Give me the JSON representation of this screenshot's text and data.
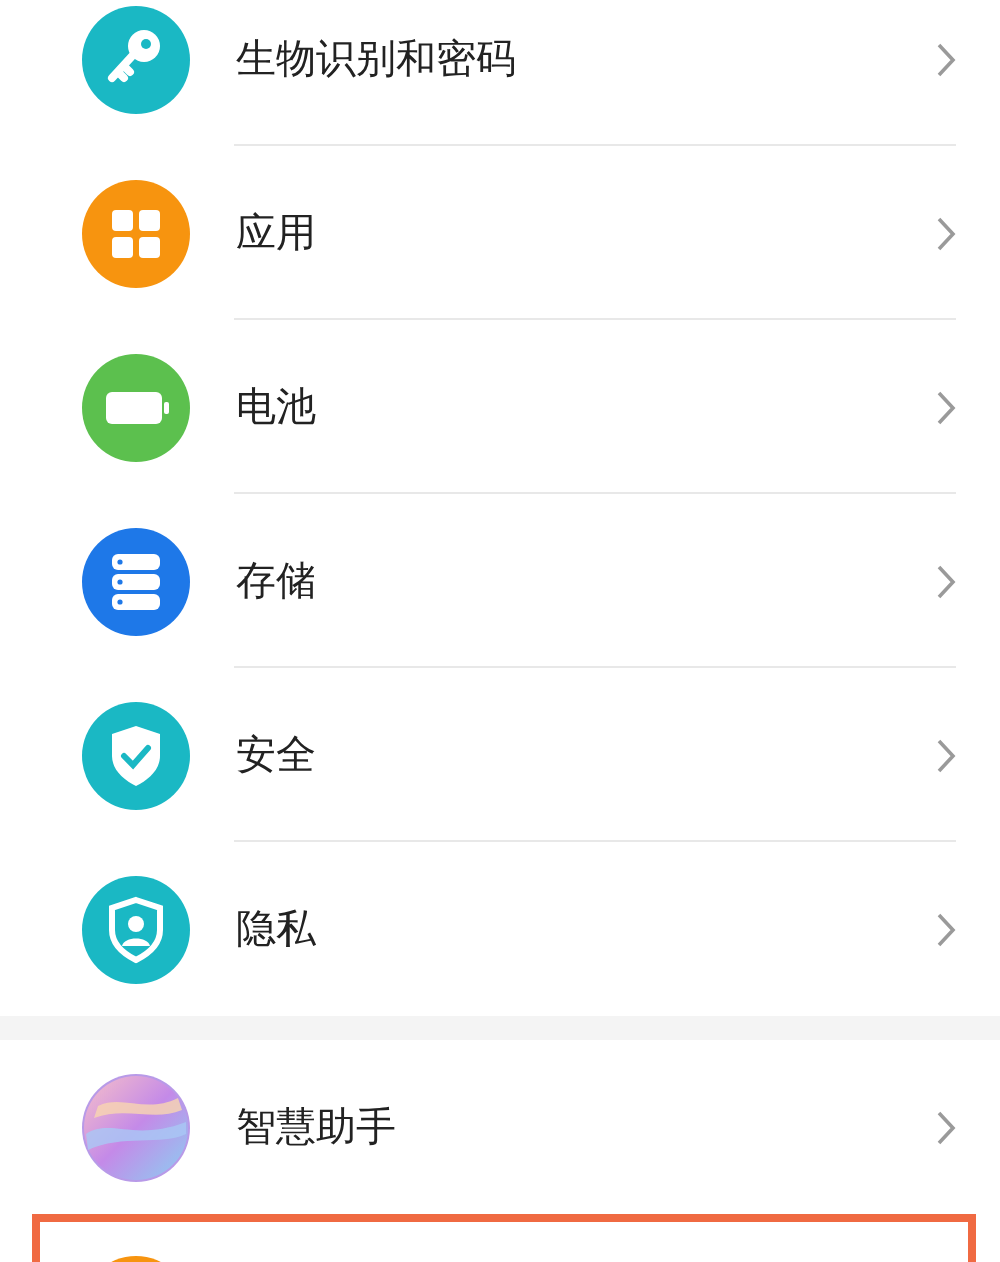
{
  "groups": [
    {
      "items": [
        {
          "label": "生物识别和密码",
          "kind": "key",
          "color": "#1ab8c4",
          "highlighted": false
        },
        {
          "label": "应用",
          "kind": "apps",
          "color": "#f7940f",
          "highlighted": false
        },
        {
          "label": "电池",
          "kind": "battery",
          "color": "#5cc04e",
          "highlighted": false
        },
        {
          "label": "存储",
          "kind": "storage",
          "color": "#1e78e8",
          "highlighted": false
        },
        {
          "label": "安全",
          "kind": "shield",
          "color": "#1ab8c4",
          "highlighted": false
        },
        {
          "label": "隐私",
          "kind": "privacy",
          "color": "#1ab8c4",
          "highlighted": false
        }
      ]
    },
    {
      "items": [
        {
          "label": "智慧助手",
          "kind": "assistant",
          "color": "#b89ae8",
          "highlighted": false
        },
        {
          "kind": "plain",
          "color": "#f7940f",
          "highlighted": true
        }
      ]
    }
  ]
}
